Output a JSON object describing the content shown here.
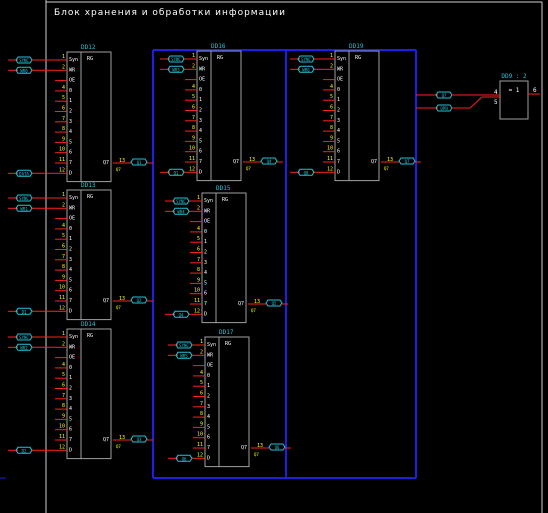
{
  "sheet_title": "Блок хранения и обработки информации",
  "colors": {
    "background": "#000000",
    "frame": "#d0d0d0",
    "chip_outline": "#a0a0a0",
    "chip_text": "#ffffff",
    "chip_name": "#22c4d8",
    "pin_number": "#ffff00",
    "wire": "#ff2020",
    "bus": "#1e1ee6",
    "port": "#22c4d8"
  },
  "chip_common": {
    "type_label": "RG",
    "output_pin_label": "Q7",
    "output_pin_number": "13",
    "inputs": [
      {
        "pin": "1",
        "label": "Syn"
      },
      {
        "pin": "2",
        "label": "WR"
      },
      {
        "pin": "",
        "label": "OE"
      },
      {
        "pin": "4",
        "label": "0"
      },
      {
        "pin": "5",
        "label": "1"
      },
      {
        "pin": "6",
        "label": "2"
      },
      {
        "pin": "7",
        "label": "3"
      },
      {
        "pin": "8",
        "label": "4"
      },
      {
        "pin": "9",
        "label": "5"
      },
      {
        "pin": "10",
        "label": "6"
      },
      {
        "pin": "11",
        "label": "7"
      },
      {
        "pin": "12",
        "label": "D"
      }
    ]
  },
  "chips": [
    {
      "name": "DD12",
      "ports": [
        "SYNC",
        "WR0",
        "DATA"
      ],
      "out_port": "Q1"
    },
    {
      "name": "DD13",
      "ports": [
        "SYNC",
        "WR1",
        "D1"
      ],
      "out_port": "Q2"
    },
    {
      "name": "DD14",
      "ports": [
        "SYNC",
        "WR2",
        "D2"
      ],
      "out_port": "Q3"
    },
    {
      "name": "DD16",
      "ports": [
        "SYNC",
        "WR3",
        "Q1"
      ],
      "out_port": "Q4"
    },
    {
      "name": "DD15",
      "ports": [
        "SYNC",
        "WR4",
        "Q4"
      ],
      "out_port": "Q5"
    },
    {
      "name": "DD17",
      "ports": [
        "SYNC",
        "WR5",
        "Q6"
      ],
      "out_port": "Q6"
    },
    {
      "name": "DD19",
      "ports": [
        "SYNC",
        "WR6",
        "Q8"
      ],
      "out_port": "Q7"
    }
  ],
  "gate": {
    "name": "DD9 : 2",
    "symbol": "= 1",
    "input_pins": [
      "4",
      "5"
    ],
    "output_pin": "6",
    "input_ports": [
      "Q7",
      "OPN"
    ]
  },
  "chip_pin_tag": "Q7"
}
